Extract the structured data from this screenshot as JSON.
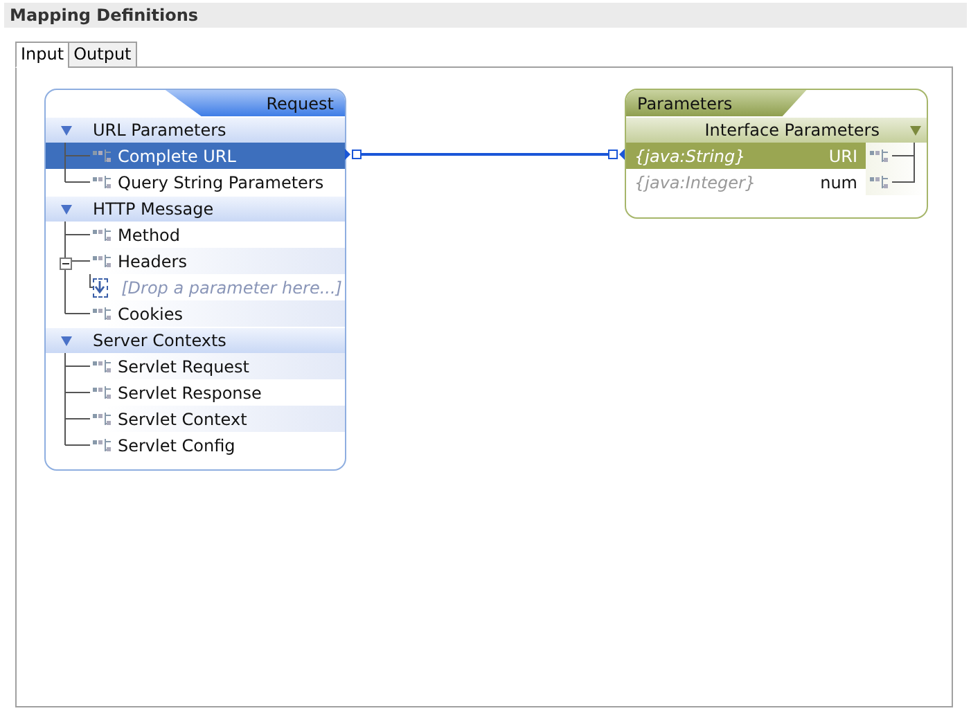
{
  "title": "Mapping Definitions",
  "tabs": [
    {
      "label": "Input",
      "selected": true
    },
    {
      "label": "Output",
      "selected": false
    }
  ],
  "request_node": {
    "title": "Request",
    "sections": [
      {
        "title": "URL Parameters",
        "expanded": true,
        "items": [
          {
            "kind": "param",
            "label": "Complete URL",
            "selected": true
          },
          {
            "kind": "param",
            "label": "Query String Parameters",
            "selected": false
          }
        ]
      },
      {
        "title": "HTTP Message",
        "expanded": true,
        "items": [
          {
            "kind": "param",
            "label": "Method",
            "selected": false
          },
          {
            "kind": "param",
            "label": "Headers",
            "selected": false,
            "expanded": true,
            "children": [
              {
                "kind": "drop",
                "label": "[Drop a parameter here...]",
                "selected": false
              }
            ]
          },
          {
            "kind": "param",
            "label": "Cookies",
            "selected": false
          }
        ]
      },
      {
        "title": "Server Contexts",
        "expanded": true,
        "items": [
          {
            "kind": "param",
            "label": "Servlet Request",
            "selected": false
          },
          {
            "kind": "param",
            "label": "Servlet Response",
            "selected": false
          },
          {
            "kind": "param",
            "label": "Servlet Context",
            "selected": false
          },
          {
            "kind": "param",
            "label": "Servlet Config",
            "selected": false
          }
        ]
      }
    ]
  },
  "parameters_node": {
    "title": "Parameters",
    "section": {
      "title": "Interface Parameters",
      "expanded": true
    },
    "rows": [
      {
        "type": "{java:String}",
        "name": "URI",
        "selected": true
      },
      {
        "type": "{java:Integer}",
        "name": "num",
        "selected": false
      }
    ]
  }
}
